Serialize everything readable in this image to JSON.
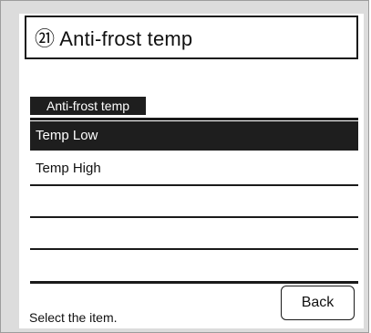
{
  "header": {
    "title": "㉑ Anti-frost temp"
  },
  "section": {
    "label": "Anti-frost temp"
  },
  "list": {
    "items": [
      {
        "label": "Temp Low",
        "selected": true
      },
      {
        "label": "Temp High",
        "selected": false
      },
      {
        "label": "",
        "selected": false
      },
      {
        "label": "",
        "selected": false
      },
      {
        "label": "",
        "selected": false
      }
    ]
  },
  "footer": {
    "status": "Select the item.",
    "back_label": "Back"
  }
}
